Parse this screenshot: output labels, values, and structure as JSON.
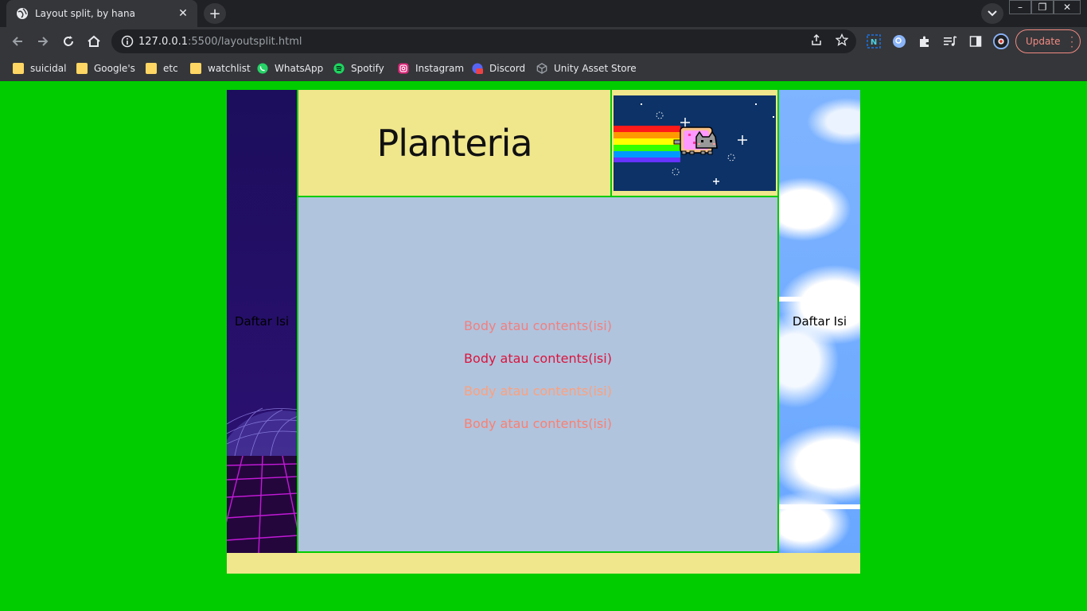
{
  "browser": {
    "tab_title": "Layout split, by hana",
    "url_host": "127.0.0.1",
    "url_path": ":5500/layoutsplit.html",
    "update_label": "Update",
    "bookmarks": [
      {
        "label": "suicidal",
        "icon": "folder-icon"
      },
      {
        "label": "Google's",
        "icon": "folder-icon"
      },
      {
        "label": "etc",
        "icon": "folder-icon"
      },
      {
        "label": "watchlist",
        "icon": "folder-icon"
      },
      {
        "label": "WhatsApp",
        "icon": "whatsapp-icon"
      },
      {
        "label": "Spotify",
        "icon": "spotify-icon"
      },
      {
        "label": "Instagram",
        "icon": "instagram-icon"
      },
      {
        "label": "Discord",
        "icon": "discord-icon"
      },
      {
        "label": "Unity Asset Store",
        "icon": "unity-icon"
      }
    ]
  },
  "page": {
    "header_title": "Planteria",
    "left_sidebar_label": "Daftar Isi",
    "right_sidebar_label": "Daftar Isi",
    "body_lines": [
      {
        "text": "Body atau contents(isi)",
        "color": "#f08080"
      },
      {
        "text": "Body atau contents(isi)",
        "color": "#dc143c"
      },
      {
        "text": "Body atau contents(isi)",
        "color": "#ffa07a"
      },
      {
        "text": "Body atau contents(isi)",
        "color": "#fa8072"
      }
    ],
    "colors": {
      "background": "#00cc00",
      "header": "#f0e68c",
      "content": "#b0c4de",
      "footer": "#f0e68c"
    }
  }
}
